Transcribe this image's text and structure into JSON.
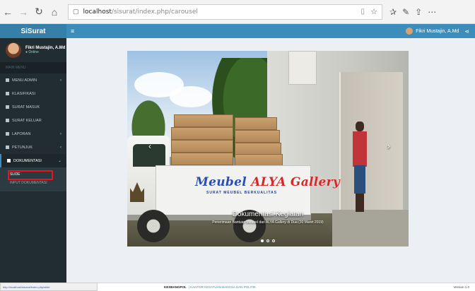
{
  "browser": {
    "url_host": "localhost",
    "url_path": "/sisurat/index.php/carousel",
    "icons": [
      "back-icon",
      "forward-icon",
      "refresh-icon",
      "home-icon",
      "reading-view-icon",
      "favorite-icon",
      "favorites-bar-icon",
      "notes-icon",
      "share-icon",
      "more-icon"
    ]
  },
  "app": {
    "logo": "SiSurat",
    "hamburger": "≡",
    "top_user": "Fikri Mustajin, A.Md"
  },
  "sidebar": {
    "user_name": "Fikri Mustajin, A.Md",
    "user_status": "● Online",
    "header": "MAIN MENU",
    "items": [
      {
        "label": "MENU ADMIN",
        "chevron": "‹"
      },
      {
        "label": "KLASIFIKASI",
        "chevron": ""
      },
      {
        "label": "SURAT MASUK",
        "chevron": ""
      },
      {
        "label": "SURAT KELUAR",
        "chevron": ""
      },
      {
        "label": "LAPORAN",
        "chevron": "‹"
      },
      {
        "label": "PETUNJUK",
        "chevron": "‹"
      },
      {
        "label": "DOKUMENTASI",
        "chevron": "⌄"
      }
    ],
    "submenu": [
      "SLIDE",
      "INPUT DOKUMENTASI"
    ]
  },
  "carousel": {
    "truck_decal_prefix": "Meubel ",
    "truck_decal_brand": "ALYA Gallery",
    "truck_decal_sub": "SURAT MEUBEL BERKUALITAS",
    "caption_title": "Dokumentasi Kegiatan",
    "caption_text": "Penerimaan Bantuan Meubel dari ALYA Gallery di Dua (30 Maret 2019)",
    "prev": "‹",
    "next": "›",
    "slides": 3
  },
  "footer": {
    "brand": "KESBANGPOL",
    "org": "| KANTOR KESATUAN BANGSA DAN POLITIK",
    "version": "Version 1.0"
  },
  "status_bar": {
    "url": "http://localhost/sisurat/index.php/slide"
  },
  "colors": {
    "topbar": "#3c8dbc",
    "sidebar": "#222d32",
    "highlight": "#e8141e"
  }
}
